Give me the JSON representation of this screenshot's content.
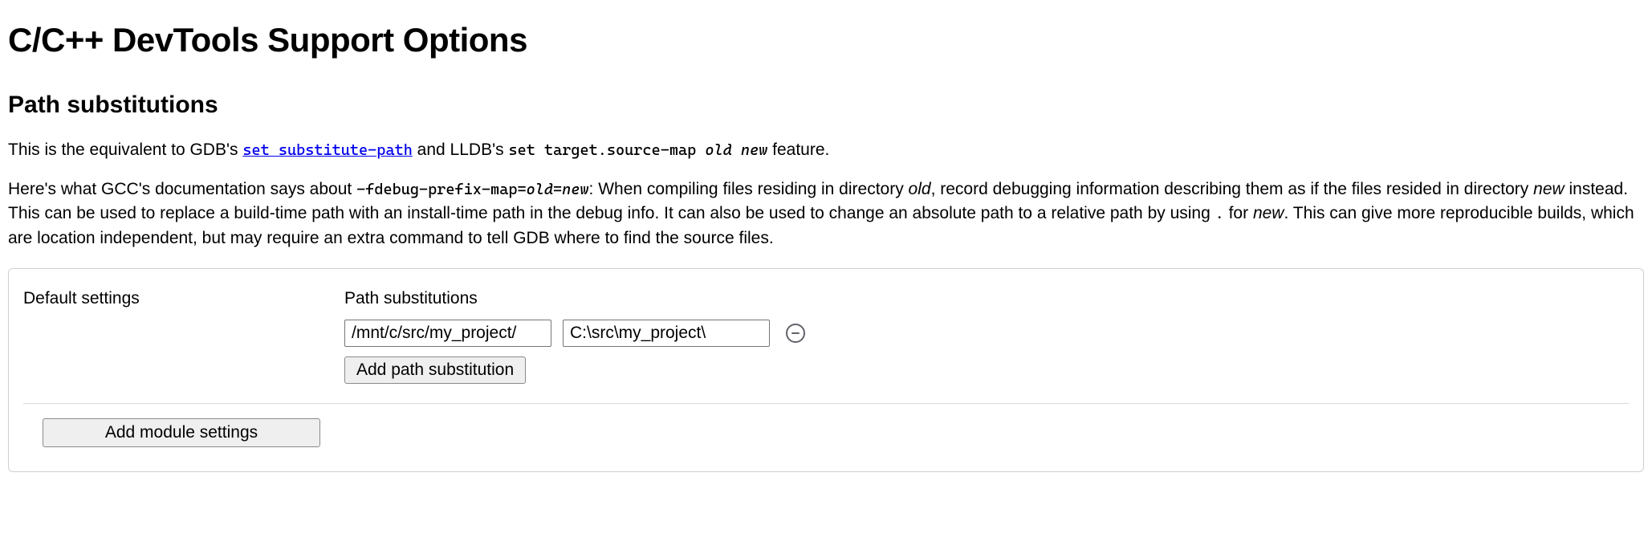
{
  "page_title": "C/C++ DevTools Support Options",
  "section_heading": "Path substitutions",
  "intro": {
    "prefix": "This is the equivalent to GDB's ",
    "gdb_link_text": "set substitute-path",
    "mid": " and LLDB's ",
    "lldb_cmd_prefix": "set target.source-map ",
    "lldb_old": "old",
    "lldb_space": " ",
    "lldb_new": "new",
    "suffix": " feature."
  },
  "gcc": {
    "p1": "Here's what GCC's documentation says about ",
    "flag_prefix": "-fdebug-prefix-map=",
    "flag_old": "old",
    "flag_eq": "=",
    "flag_new": "new",
    "p2a": ": When compiling files residing in directory ",
    "old2": "old",
    "p2b": ", record debugging information describing them as if the files resided in directory ",
    "new2": "new",
    "p2c": " instead. This can be used to replace a build-time path with an install-time path in the debug info. It can also be used to change an absolute path to a relative path by using ",
    "dot": ".",
    "p2d": " for ",
    "new3": "new",
    "p2e": ". This can give more reproducible builds, which are location independent, but may require an extra command to tell GDB where to find the source files."
  },
  "panel": {
    "default_label": "Default settings",
    "subhead": "Path substitutions",
    "entries": [
      {
        "from": "/mnt/c/src/my_project/",
        "to": "C:\\src\\my_project\\"
      }
    ],
    "add_button": "Add path substitution",
    "add_module_button": "Add module settings"
  }
}
